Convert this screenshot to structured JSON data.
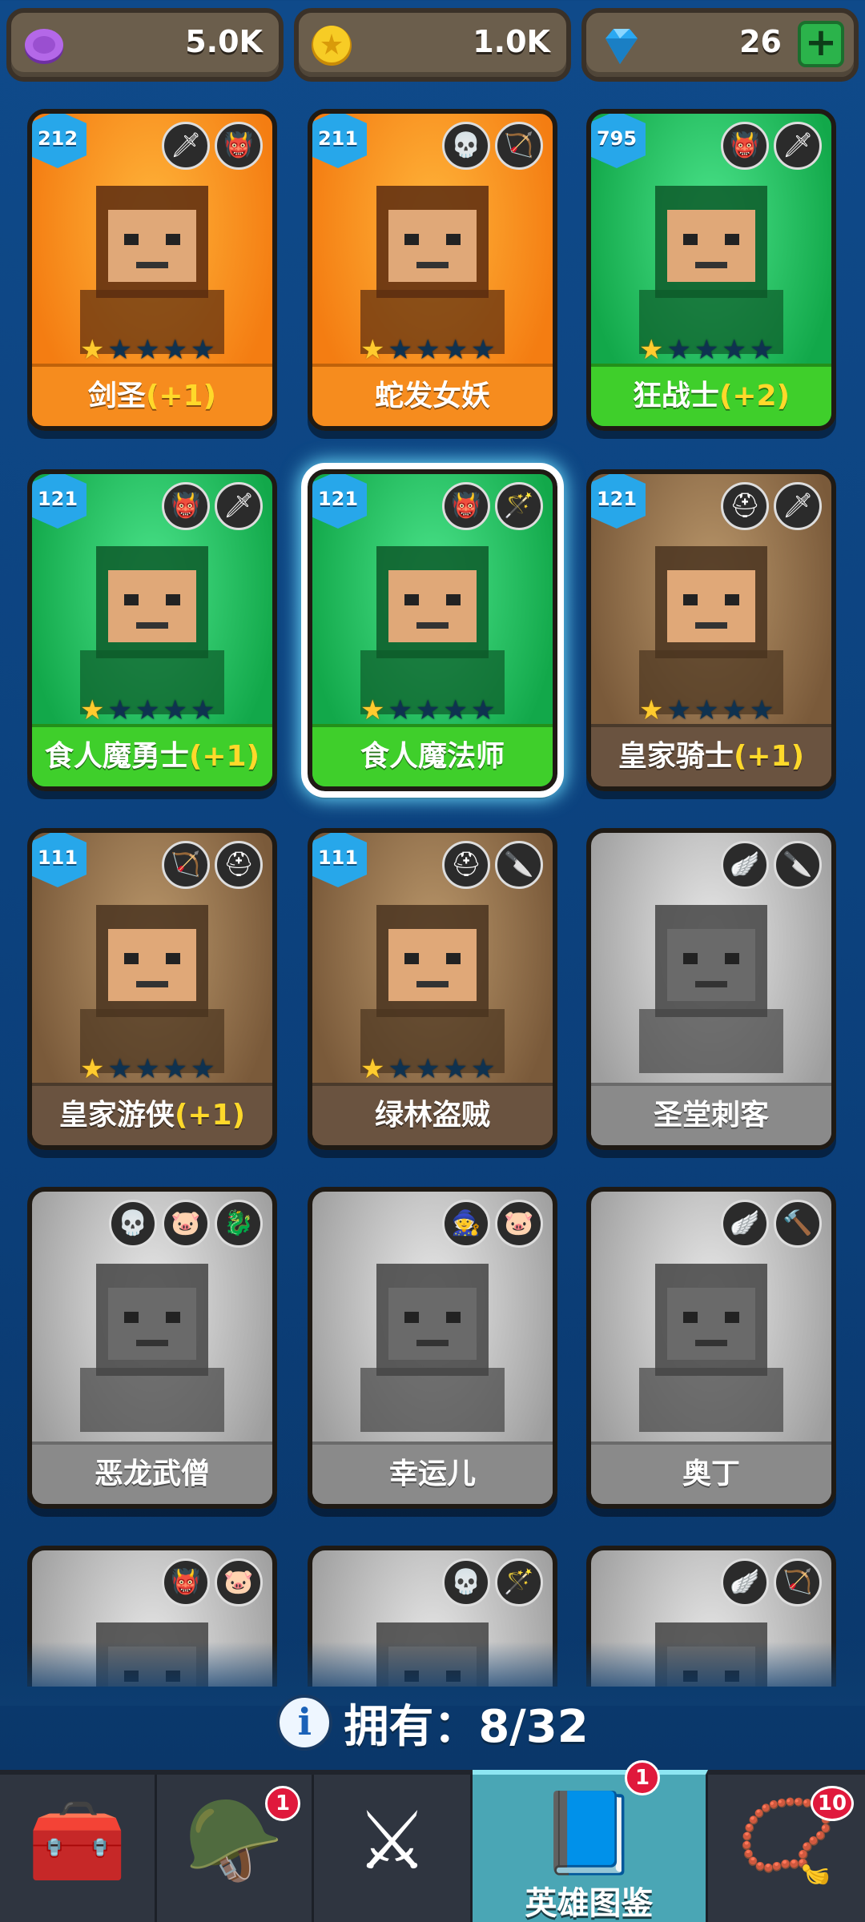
{
  "resources": [
    {
      "name": "purple-currency",
      "value": "5.0K",
      "color": "#a35cd6"
    },
    {
      "name": "gold-coin",
      "value": "1.0K",
      "color": "#f4c21d"
    },
    {
      "name": "gems",
      "value": "26",
      "color": "#2aa8f2",
      "add_label": "+"
    }
  ],
  "heroes": [
    {
      "name": "剑圣",
      "bonus": "(+1)",
      "level": "212",
      "stars": 1,
      "theme": "orange",
      "badges": [
        "🗡",
        "👹"
      ]
    },
    {
      "name": "蛇发女妖",
      "bonus": "",
      "level": "211",
      "stars": 1,
      "theme": "orange",
      "badges": [
        "💀",
        "🏹"
      ]
    },
    {
      "name": "狂战士",
      "bonus": "(+2)",
      "level": "795",
      "stars": 1,
      "theme": "green",
      "badges": [
        "👹",
        "🗡"
      ]
    },
    {
      "name": "食人魔勇士",
      "bonus": "(+1)",
      "level": "121",
      "stars": 1,
      "theme": "green",
      "badges": [
        "👹",
        "🗡"
      ]
    },
    {
      "name": "食人魔法师",
      "bonus": "",
      "level": "121",
      "stars": 1,
      "theme": "green",
      "badges": [
        "👹",
        "🪄"
      ],
      "selected": true
    },
    {
      "name": "皇家骑士",
      "bonus": "(+1)",
      "level": "121",
      "stars": 1,
      "theme": "brown",
      "badges": [
        "⛑",
        "🗡"
      ]
    },
    {
      "name": "皇家游侠",
      "bonus": "(+1)",
      "level": "111",
      "stars": 1,
      "theme": "brown",
      "badges": [
        "🏹",
        "⛑"
      ]
    },
    {
      "name": "绿林盗贼",
      "bonus": "",
      "level": "111",
      "stars": 1,
      "theme": "brown",
      "badges": [
        "⛑",
        "🔪"
      ]
    },
    {
      "name": "圣堂刺客",
      "bonus": "",
      "level": "",
      "stars": 0,
      "theme": "grey",
      "badges": [
        "🪽",
        "🔪"
      ]
    },
    {
      "name": "恶龙武僧",
      "bonus": "",
      "level": "",
      "stars": 0,
      "theme": "grey",
      "badges": [
        "💀",
        "🐷",
        "🐉"
      ]
    },
    {
      "name": "幸运儿",
      "bonus": "",
      "level": "",
      "stars": 0,
      "theme": "grey",
      "badges": [
        "🧙",
        "🐷"
      ]
    },
    {
      "name": "奥丁",
      "bonus": "",
      "level": "",
      "stars": 0,
      "theme": "grey",
      "badges": [
        "🪽",
        "🔨"
      ]
    },
    {
      "name": "",
      "bonus": "",
      "level": "",
      "stars": 0,
      "theme": "grey",
      "badges": [
        "👹",
        "🐷"
      ]
    },
    {
      "name": "",
      "bonus": "",
      "level": "",
      "stars": 0,
      "theme": "grey",
      "badges": [
        "💀",
        "🪄"
      ]
    },
    {
      "name": "",
      "bonus": "",
      "level": "",
      "stars": 0,
      "theme": "grey",
      "badges": [
        "🪽",
        "🏹"
      ]
    }
  ],
  "owned": {
    "label": "拥有：",
    "count": "8/32",
    "info_icon": "i"
  },
  "nav": [
    {
      "name": "chest",
      "icon": "🧰",
      "badge": ""
    },
    {
      "name": "helmet",
      "icon": "🪖",
      "badge": "1"
    },
    {
      "name": "battle",
      "icon": "⚔",
      "badge": ""
    },
    {
      "name": "hero-codex",
      "icon": "📘",
      "badge": "1",
      "label": "英雄图鉴",
      "active": true
    },
    {
      "name": "amulet",
      "icon": "📿",
      "badge": "10"
    }
  ]
}
